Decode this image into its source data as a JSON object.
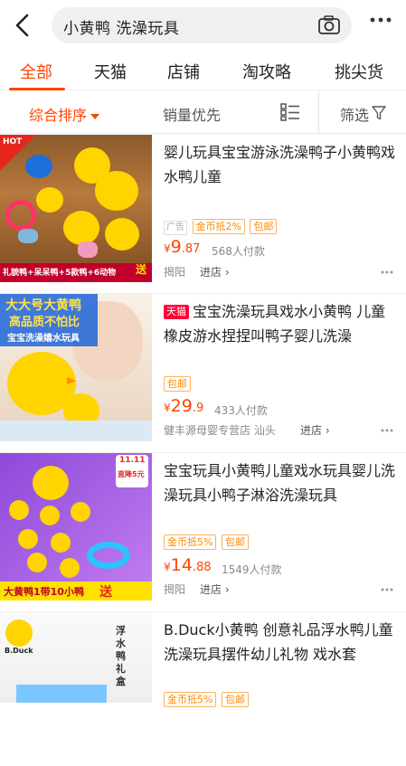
{
  "search": {
    "query": "小黄鸭 洗澡玩具"
  },
  "tabs": [
    {
      "label": "全部",
      "active": true
    },
    {
      "label": "天猫"
    },
    {
      "label": "店铺"
    },
    {
      "label": "淘攻略"
    },
    {
      "label": "挑尖货"
    }
  ],
  "sort": {
    "composite": "综合排序",
    "sales": "销量优先",
    "filter": "筛选"
  },
  "products": [
    {
      "title": "婴儿玩具宝宝游泳洗澡鸭子小黄鸭戏水鸭儿童",
      "ad": "广告",
      "coin": "金币抵2%",
      "shipping": "包邮",
      "price_yen": "¥",
      "price_int": "9",
      "price_dec": ".87",
      "sold": "568人付款",
      "location": "揭阳",
      "shop": "进店",
      "image": {
        "hot": "HOT",
        "line1": "礼貌鸭+呆呆鸭+5款鸭+6动物",
        "send": "送"
      }
    },
    {
      "badge": "天猫",
      "title": "宝宝洗澡玩具戏水小黄鸭 儿童橡皮游水捏捏叫鸭子婴儿洗澡",
      "shipping": "包邮",
      "price_yen": "¥",
      "price_int": "29",
      "price_dec": ".9",
      "sold": "433人付款",
      "shop_name": "健丰源母婴专营店 汕头",
      "shop": "进店",
      "image": {
        "line1": "大大号大黄鸭",
        "line2": "高品质不怕比",
        "line3": "宝宝洗澡嬉水玩具"
      }
    },
    {
      "title": "宝宝玩具小黄鸭儿童戏水玩具婴儿洗澡玩具小鸭子淋浴洗澡玩具",
      "coin": "金币抵5%",
      "shipping": "包邮",
      "price_yen": "¥",
      "price_int": "14",
      "price_dec": ".88",
      "sold": "1549人付款",
      "location": "揭阳",
      "shop": "进店",
      "image": {
        "promo1": "11.11",
        "promo2": "直降5元",
        "bottom": "大黄鸭1带10小鸭",
        "send": "送"
      }
    },
    {
      "title": "B.Duck小黄鸭 创意礼品浮水鸭儿童洗澡玩具摆件幼儿礼物 戏水套",
      "coin": "金币抵5%",
      "shipping": "包邮",
      "image": {
        "brand": "B.Duck",
        "vertical": "浮水鸭礼盒"
      }
    }
  ],
  "colors": {
    "accent": "#ff4400",
    "tmall": "#ff0036",
    "coupon": "#ff8a00"
  }
}
